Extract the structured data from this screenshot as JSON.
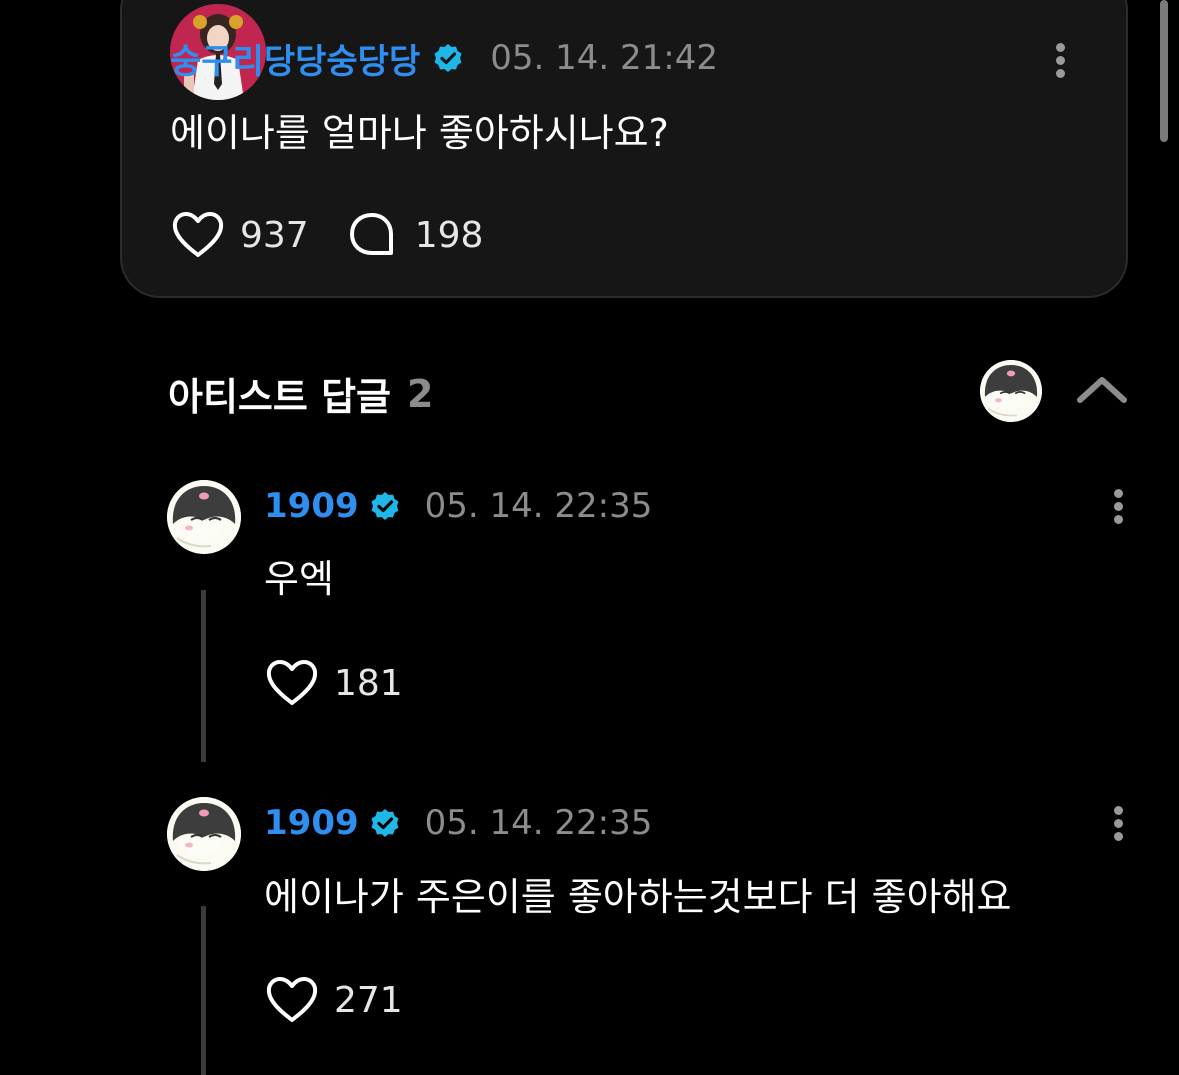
{
  "post": {
    "author": "숭구리당당숭당당",
    "date": "05. 14. 21:42",
    "text": "에이나를 얼마나 좋아하시나요?",
    "likes": "937",
    "comments": "198"
  },
  "replies_header": {
    "title": "아티스트 답글",
    "count": "2"
  },
  "replies": [
    {
      "author": "1909",
      "date": "05. 14. 22:35",
      "text": "우엑",
      "likes": "181"
    },
    {
      "author": "1909",
      "date": "05. 14. 22:35",
      "text": "에이나가 주은이를 좋아하는것보다 더 좋아해요",
      "likes": "271"
    }
  ],
  "colors": {
    "accent": "#2f8ff0",
    "verified": "#1fb6e8",
    "background": "#000000",
    "card": "#161616"
  },
  "icons": [
    "verified-badge-icon",
    "heart-icon",
    "comment-icon",
    "more-options-icon",
    "chevron-up-icon"
  ]
}
